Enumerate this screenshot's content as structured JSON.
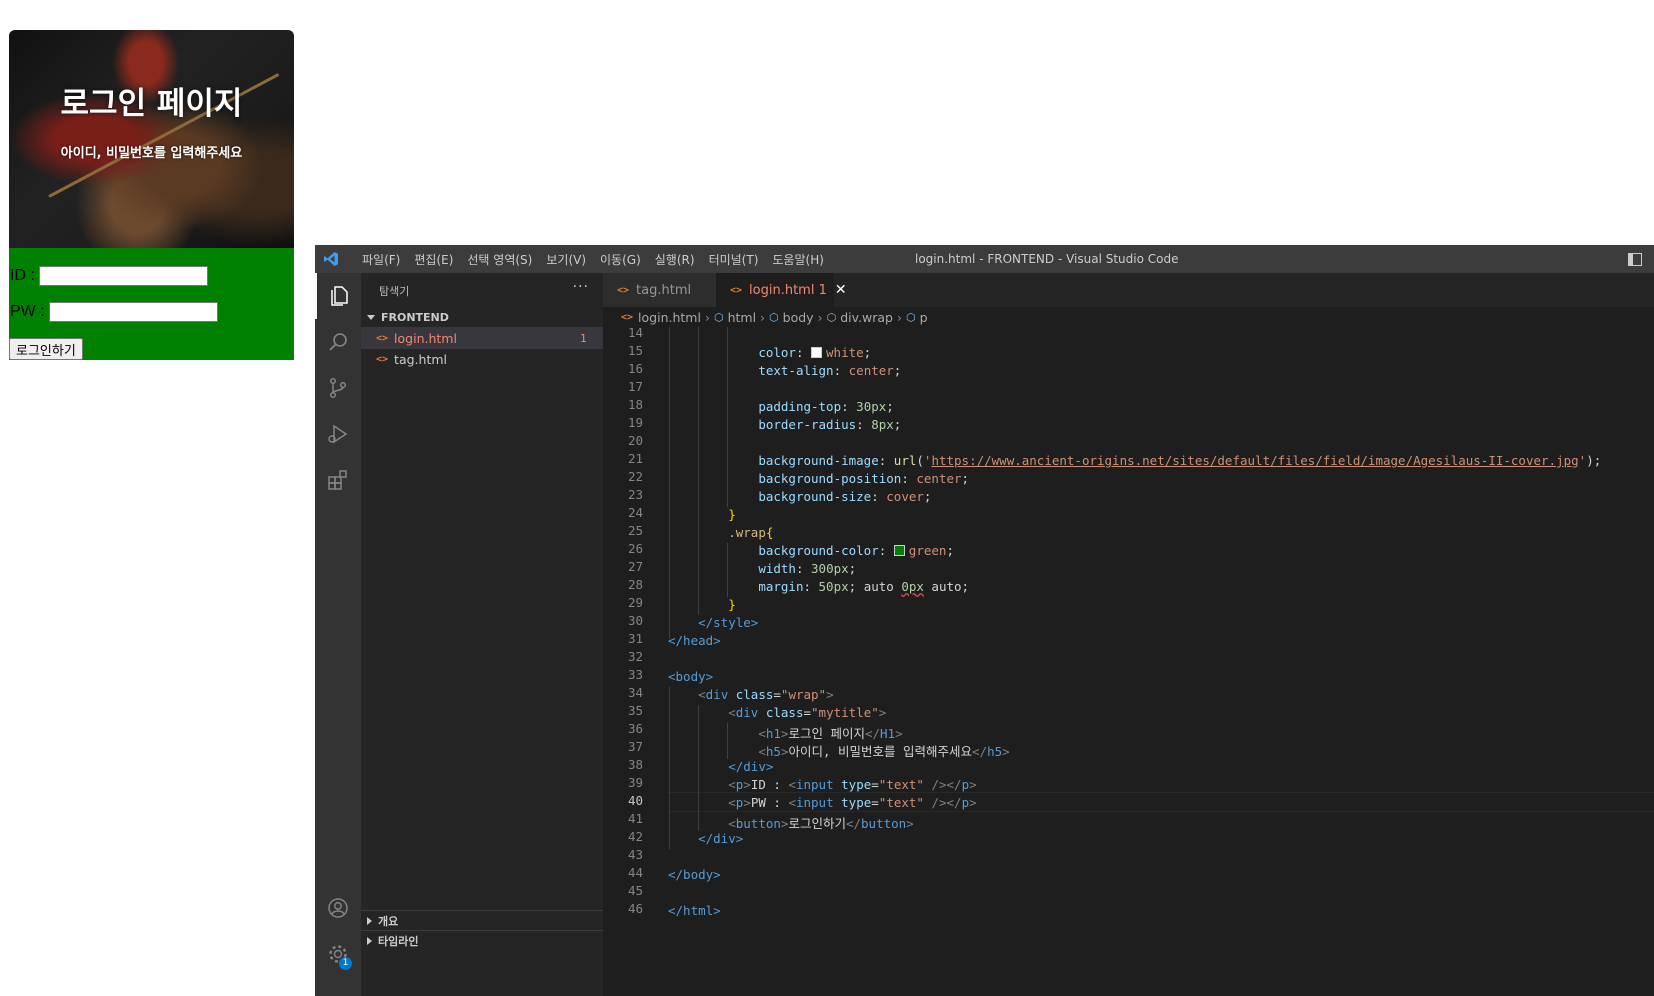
{
  "preview": {
    "title": "로그인 페이지",
    "subtitle": "아이디, 비밀번호를 입력해주세요",
    "id_label": "ID :",
    "pw_label": "PW :",
    "id_value": "",
    "pw_value": "",
    "login_button": "로그인하기",
    "colors": {
      "wrap_bg": "#008000",
      "title_text": "#ffffff"
    }
  },
  "vscode": {
    "menu": [
      "파일(F)",
      "편집(E)",
      "선택 영역(S)",
      "보기(V)",
      "이동(G)",
      "실행(R)",
      "터미널(T)",
      "도움말(H)"
    ],
    "window_title": "login.html - FRONTEND - Visual Studio Code",
    "activity_icons": [
      "explorer-icon",
      "search-icon",
      "source-control-icon",
      "run-debug-icon",
      "extensions-icon",
      "account-icon",
      "settings-gear-icon"
    ],
    "settings_badge": "1",
    "sidebar": {
      "header": "탐색기",
      "more": "···",
      "folder": "FRONTEND",
      "files": [
        {
          "name": "login.html",
          "problems": "1"
        },
        {
          "name": "tag.html",
          "problems": ""
        }
      ],
      "sections": [
        "개요",
        "타임라인"
      ]
    },
    "tabs": [
      {
        "label": "tag.html"
      },
      {
        "label": "login.html",
        "problems": "1"
      }
    ],
    "breadcrumb": [
      "login.html",
      "html",
      "body",
      "div.wrap",
      "p"
    ],
    "current_line": 40,
    "line_numbers": [
      14,
      15,
      16,
      17,
      18,
      19,
      20,
      21,
      22,
      23,
      24,
      25,
      26,
      27,
      28,
      29,
      30,
      31,
      32,
      33,
      34,
      35,
      36,
      37,
      38,
      39,
      40,
      41,
      42,
      43,
      44,
      45,
      46
    ],
    "code": {
      "l15_prop": "color",
      "l15_val": "white",
      "l16_prop": "text-align",
      "l16_val": "center",
      "l18_prop": "padding-top",
      "l18_val": "30px",
      "l19_prop": "border-radius",
      "l19_val": "8px",
      "l21_prop": "background-image",
      "l21_url": "https://www.ancient-origins.net/sites/default/files/field/image/Agesilaus-II-cover.jpg",
      "l22_prop": "background-position",
      "l22_val": "center",
      "l23_prop": "background-size",
      "l23_val": "cover",
      "l25_sel": ".wrap",
      "l26_prop": "background-color",
      "l26_val": "green",
      "l27_prop": "width",
      "l27_val": "300px",
      "l28_prop": "margin",
      "l28_val1": "50px",
      "l28_rest1": "; auto ",
      "l28_val2": "0px",
      "l28_rest2": " auto;",
      "l30": "</style>",
      "l31": "</head>",
      "l33": "<body>",
      "l34_class": "\"wrap\"",
      "l35_class": "\"mytitle\"",
      "l36_text": "로그인 페이지",
      "l37_text": "아이디, 비밀번호를 입력해주세요",
      "l38": "</div>",
      "l39_text": "ID : ",
      "l40_text": "PW : ",
      "input_type": "\"text\"",
      "l41_text": "로그인하기",
      "l42": "</div>",
      "l44": "</body>",
      "l46": "</html>"
    },
    "colors": {
      "editor_bg": "#1e1e1e",
      "sidebar_bg": "#252526",
      "activity_bg": "#333333",
      "titlebar_bg": "#3c3c3c",
      "error": "#f48771"
    }
  }
}
